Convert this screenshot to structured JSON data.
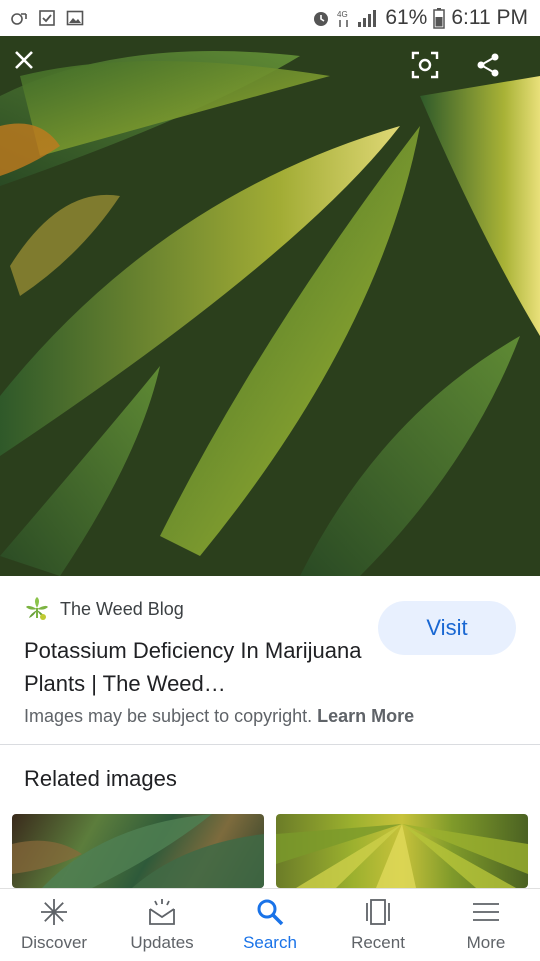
{
  "status_bar": {
    "battery": "61%",
    "time": "6:11 PM",
    "icons": [
      "missed-call-icon",
      "checkbox-icon",
      "gallery-icon",
      "alarm-icon",
      "data-icon",
      "signal-icon",
      "battery-icon"
    ]
  },
  "viewer": {
    "close_icon": "close-icon",
    "lens_icon": "lens-icon",
    "share_icon": "share-icon"
  },
  "result": {
    "source_name": "The Weed Blog",
    "title": "Potassium Deficiency In Marijuana Plants | The Weed…",
    "visit_label": "Visit",
    "copyright_text": "Images may be subject to copyright.",
    "learn_more": "Learn More"
  },
  "related": {
    "title": "Related images"
  },
  "bottom_nav": {
    "items": [
      {
        "label": "Discover",
        "icon": "discover-icon",
        "active": false
      },
      {
        "label": "Updates",
        "icon": "updates-icon",
        "active": false
      },
      {
        "label": "Search",
        "icon": "search-icon",
        "active": true
      },
      {
        "label": "Recent",
        "icon": "recent-icon",
        "active": false
      },
      {
        "label": "More",
        "icon": "menu-icon",
        "active": false
      }
    ]
  },
  "colors": {
    "accent": "#1a73e8",
    "visit_bg": "#e8f0fe",
    "visit_text": "#1967d2"
  }
}
